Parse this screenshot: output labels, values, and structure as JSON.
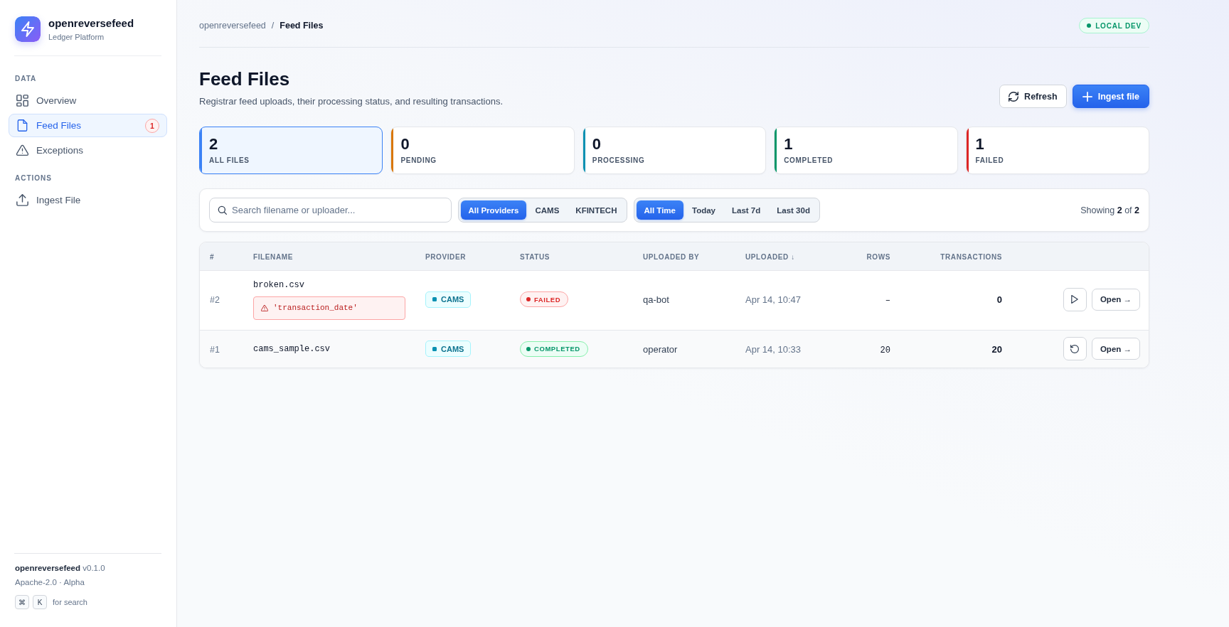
{
  "sidebar": {
    "brand": {
      "name": "openreversefeed",
      "tagline": "Ledger Platform"
    },
    "sections": [
      {
        "title": "DATA",
        "items": [
          {
            "label": "Overview",
            "kind": "grid",
            "selected": false
          },
          {
            "label": "Feed Files",
            "kind": "file",
            "selected": true,
            "badge": "1"
          },
          {
            "label": "Exceptions",
            "kind": "warning",
            "selected": false
          }
        ]
      },
      {
        "title": "ACTIONS",
        "items": [
          {
            "label": "Ingest File",
            "kind": "upload",
            "selected": false
          }
        ]
      }
    ],
    "footer": {
      "version": "**openreversefeed** v0.1.0",
      "license": "Apache-2.0 · Alpha",
      "shortcut": {
        "keys": [
          "⌘",
          "K"
        ],
        "hint": "for search"
      }
    }
  },
  "header": {
    "breadcrumb": {
      "parent": "openreversefeed",
      "separator": "/",
      "current": "Feed Files"
    },
    "environment": "LOCAL DEV"
  },
  "page": {
    "title": "Feed Files",
    "subtitle": "Registrar feed uploads, their processing status, and resulting transactions.",
    "buttons": [
      {
        "label": "Refresh",
        "kind": "secondary"
      },
      {
        "label": "Ingest file",
        "kind": "primary"
      }
    ]
  },
  "stats": [
    {
      "value": "2",
      "label": "ALL FILES",
      "color": "#3b82f6",
      "selected": true
    },
    {
      "value": "0",
      "label": "PENDING",
      "color": "#d97706",
      "selected": false
    },
    {
      "value": "0",
      "label": "PROCESSING",
      "color": "#0891b2",
      "selected": false
    },
    {
      "value": "1",
      "label": "COMPLETED",
      "color": "#059669",
      "selected": false
    },
    {
      "value": "1",
      "label": "FAILED",
      "color": "#dc2626",
      "selected": false
    }
  ],
  "filters": {
    "search": {
      "placeholder": "Search filename or uploader..."
    },
    "providers": [
      {
        "label": "All Providers",
        "selected": true
      },
      {
        "label": "CAMS",
        "selected": false
      },
      {
        "label": "KFINTECH",
        "selected": false
      }
    ],
    "periods": [
      {
        "label": "All Time",
        "selected": true
      },
      {
        "label": "Today",
        "selected": false
      },
      {
        "label": "Last 7d",
        "selected": false
      },
      {
        "label": "Last 30d",
        "selected": false
      }
    ],
    "summary": "Showing **2** of **2**"
  },
  "table": {
    "columns": [
      "#",
      "FILENAME",
      "PROVIDER",
      "STATUS",
      "UPLOADED BY",
      "UPLOADED ↓",
      "ROWS",
      "TRANSACTIONS"
    ],
    "rows": [
      {
        "number": "#2",
        "filename": "broken.csv",
        "error": "'transaction_date'",
        "provider": "CAMS",
        "status": {
          "label": "FAILED",
          "kind": "failed"
        },
        "uploaded_by": "qa-bot",
        "uploaded": "Apr 14, 10:47",
        "rows": "–",
        "transactions": "0",
        "actions": [
          {
            "kind": "run"
          },
          {
            "kind": "open",
            "label": "Open →"
          }
        ]
      },
      {
        "number": "#1",
        "filename": "cams_sample.csv",
        "provider": "CAMS",
        "status": {
          "label": "COMPLETED",
          "kind": "completed"
        },
        "uploaded_by": "operator",
        "uploaded": "Apr 14, 10:33",
        "rows": "20",
        "transactions": "20",
        "actions": [
          {
            "kind": "retry"
          },
          {
            "kind": "open",
            "label": "Open →"
          }
        ]
      }
    ]
  }
}
